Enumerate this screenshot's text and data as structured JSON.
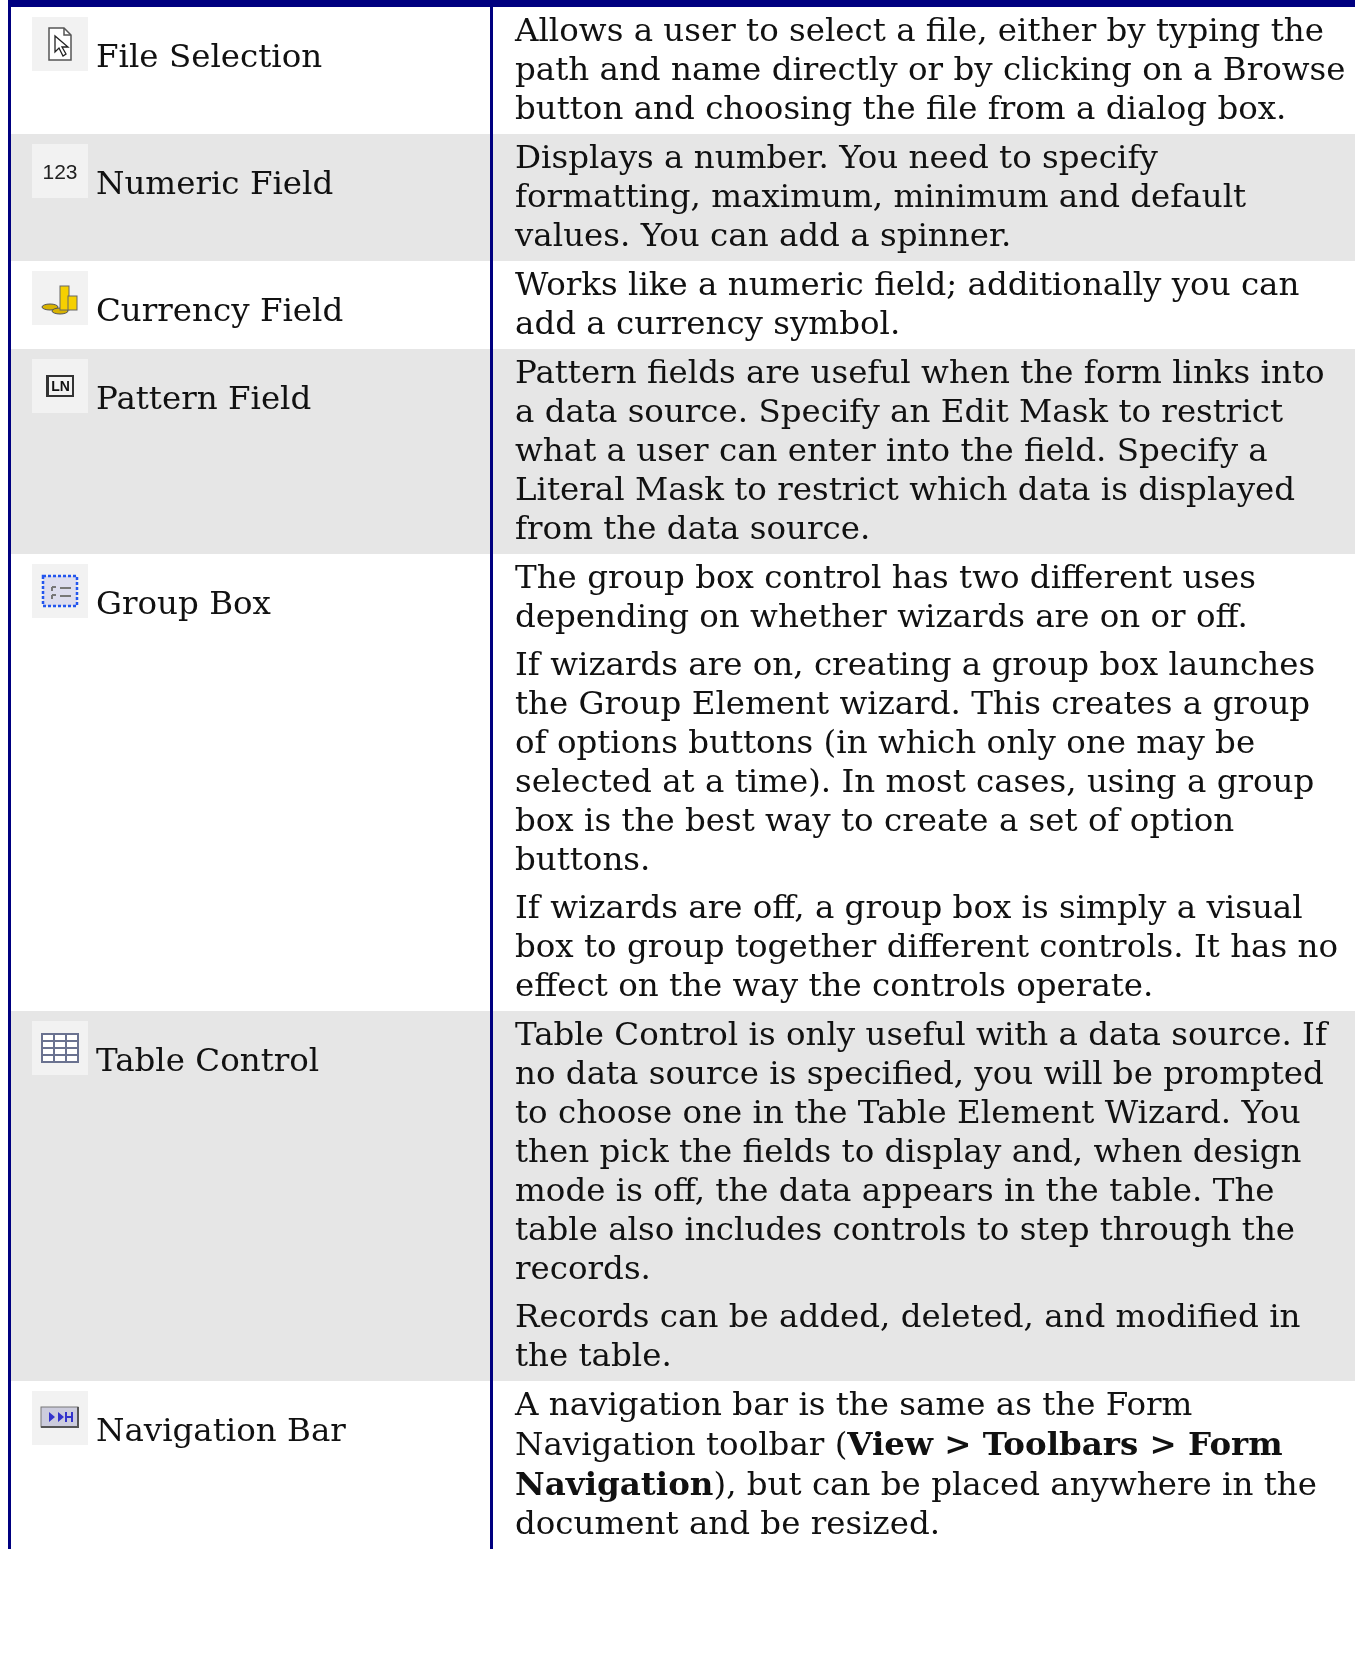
{
  "rows": [
    {
      "kind": "file",
      "label": "File Selection",
      "shaded": false,
      "paragraphs": [
        "Allows a user to select a file, either by typing the path and name directly or by clicking on a Browse button and choosing the file from a dialog box."
      ]
    },
    {
      "kind": "number",
      "icon_text": "123",
      "label": "Numeric Field",
      "shaded": true,
      "paragraphs": [
        "Displays a number. You need to specify formatting, maximum, minimum and default values. You can add a spinner."
      ]
    },
    {
      "kind": "currency",
      "label": "Currency Field",
      "shaded": false,
      "paragraphs": [
        "Works like a numeric field; additionally you can add a currency symbol."
      ]
    },
    {
      "kind": "pattern",
      "icon_text": "LN",
      "label": "Pattern Field",
      "shaded": true,
      "paragraphs": [
        "Pattern fields are useful when the form links into a data source. Specify an Edit Mask to restrict what a user can enter into the field. Specify a Literal Mask to restrict which data is displayed from the data source."
      ]
    },
    {
      "kind": "group",
      "label": "Group Box",
      "shaded": false,
      "paragraphs": [
        "The group box control has two different uses depending on whether wizards are on or off.",
        "If wizards are on, creating a group box launches the Group Element wizard. This creates a group of options buttons (in which only one may be selected at a time). In most cases, using a group box is the best way to create a set of option buttons.",
        "If wizards are off, a group box is simply a visual box to group together different controls. It has no effect on the way the controls operate."
      ]
    },
    {
      "kind": "table",
      "label": "Table Control",
      "shaded": true,
      "paragraphs": [
        "Table Control is only useful with a data source. If no data source is specified, you will be prompted to choose one in the Table Element Wizard. You then pick the fields to display and, when design mode is off, the data appears in the table. The table also includes controls to step through the records.",
        "Records can be added, deleted, and modified in the table."
      ]
    },
    {
      "kind": "navigation",
      "label": "Navigation Bar",
      "shaded": false,
      "paragraphs": [
        "A navigation bar is the same as the Form Navigation toolbar (**View > Toolbars > Form Navigation**), but can be placed anywhere in the document and be resized."
      ]
    }
  ]
}
